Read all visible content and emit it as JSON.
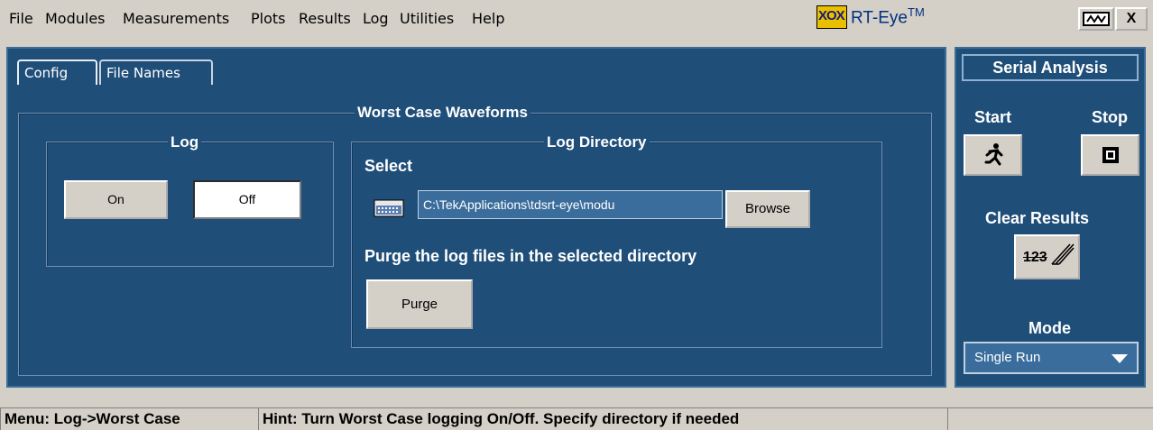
{
  "menu": [
    "File",
    "Modules",
    "Measurements",
    "Plots",
    "Results",
    "Log",
    "Utilities",
    "Help"
  ],
  "app": {
    "logo_text": "XOX",
    "title": "RT-Eye",
    "title_sup": "TM",
    "close_label": "X"
  },
  "tabs": [
    {
      "label": "Config"
    },
    {
      "label": "File Names"
    }
  ],
  "worst_case": {
    "group_title": "Worst Case Waveforms",
    "log": {
      "title": "Log",
      "on_label": "On",
      "off_label": "Off",
      "selected": "Off"
    },
    "log_directory": {
      "title": "Log Directory",
      "select_label": "Select",
      "path_value": "C:\\TekApplications\\tdsrt-eye\\modu",
      "browse_label": "Browse",
      "purge_text": "Purge the log files in the selected directory",
      "purge_label": "Purge"
    }
  },
  "right_panel": {
    "header": "Serial Analysis",
    "start_label": "Start",
    "stop_label": "Stop",
    "clear_label": "Clear Results",
    "clear_icon_text": "123",
    "mode_label": "Mode",
    "mode_value": "Single Run"
  },
  "status": {
    "menu_path": "Menu: Log->Worst Case",
    "hint": "Hint: Turn Worst Case logging On/Off. Specify directory if needed"
  },
  "colors": {
    "panel_bg": "#1f4e79",
    "chrome_bg": "#d4d0c8",
    "logo_bg": "#e8c000"
  },
  "icons": [
    "window-resize-icon",
    "folder-icon",
    "running-man-icon",
    "stop-square-icon",
    "eraser-icon",
    "chevron-down-icon"
  ]
}
